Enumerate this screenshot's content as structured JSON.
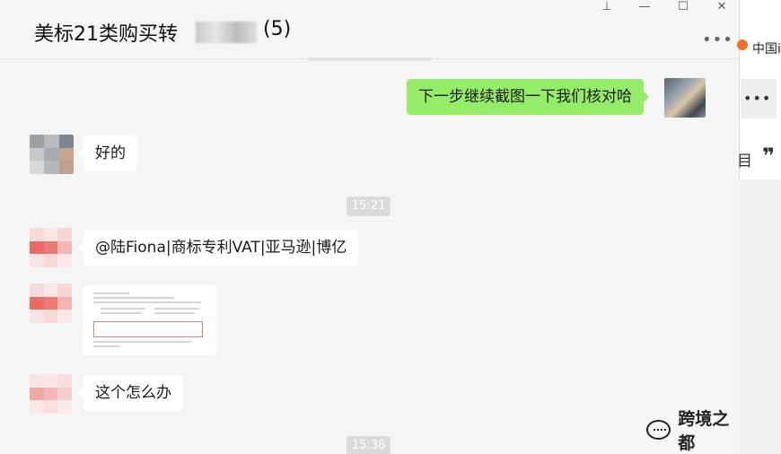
{
  "header": {
    "title": "美标21类购买转",
    "member_count": "(5)",
    "window_buttons": {
      "pin": "⊥",
      "minimize": "—",
      "maximize": "☐",
      "close": "✕"
    },
    "more": "•••"
  },
  "messages": [
    {
      "sender": "me",
      "text": "下一步继续截图一下我们核对哈"
    },
    {
      "sender": "other",
      "text": "好的"
    },
    {
      "time": "15:21"
    },
    {
      "sender": "other",
      "text": "@陆Fiona|商标专利VAT|亚马逊|博亿"
    },
    {
      "sender": "other",
      "type": "image",
      "content": "screenshot"
    },
    {
      "sender": "other",
      "text": "这个怎么办"
    },
    {
      "time": "15:38"
    }
  ],
  "watermark": {
    "text": "跨境之都",
    "icon": "wechat-icon"
  },
  "side_panel": {
    "text": "中国i",
    "dots": "•••",
    "icon1": "目",
    "icon2": "❞"
  }
}
